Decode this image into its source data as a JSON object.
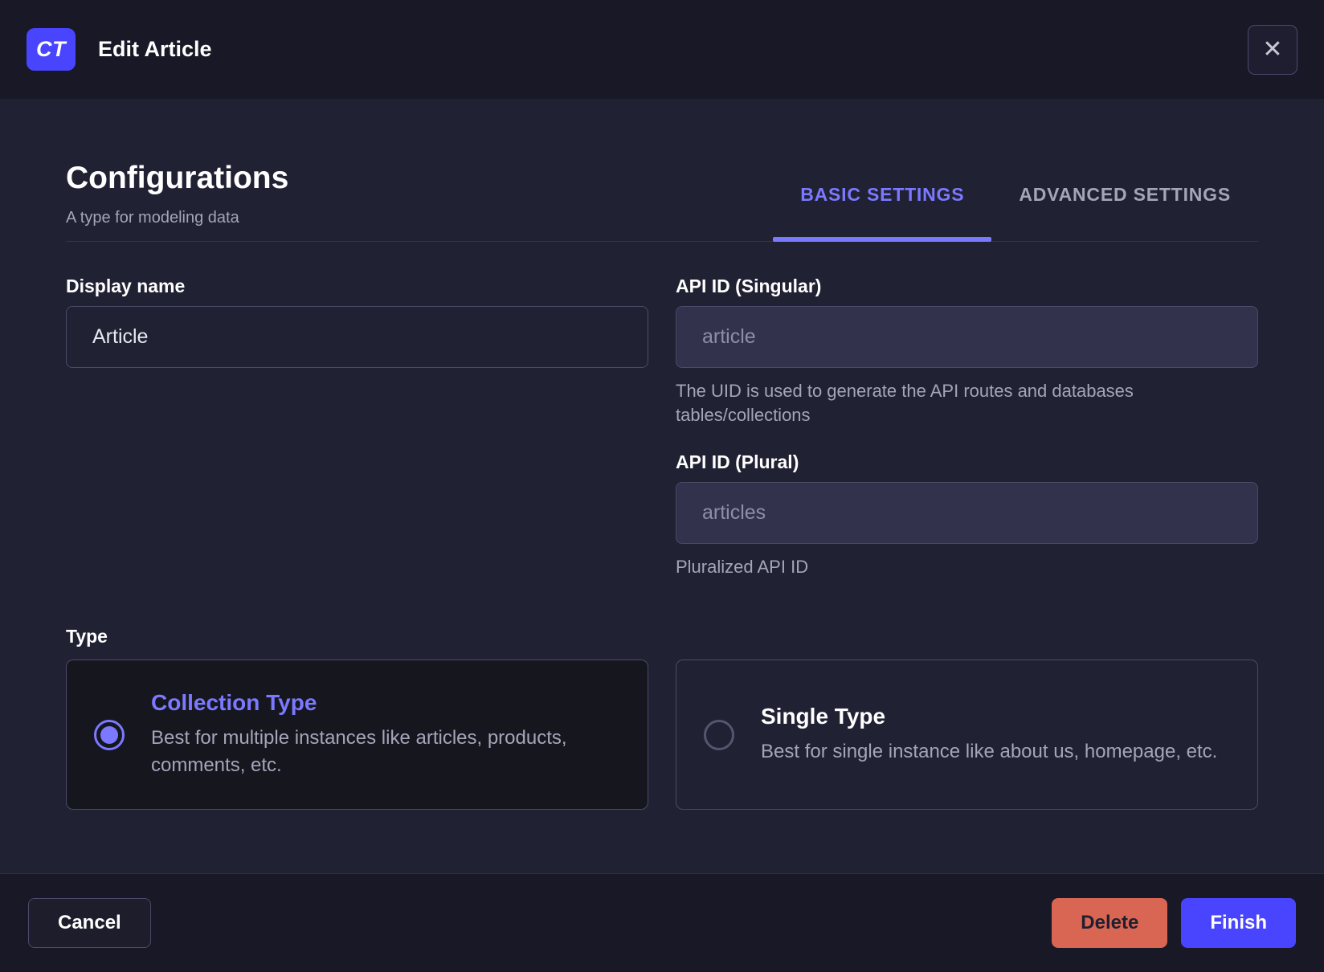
{
  "header": {
    "badge": "CT",
    "title": "Edit Article",
    "close_icon": "✕"
  },
  "config": {
    "title": "Configurations",
    "subtitle": "A type for modeling data",
    "tabs": [
      {
        "label": "BASIC SETTINGS",
        "active": true
      },
      {
        "label": "ADVANCED SETTINGS",
        "active": false
      }
    ]
  },
  "form": {
    "display_name": {
      "label": "Display name",
      "value": "Article"
    },
    "api_id_singular": {
      "label": "API ID (Singular)",
      "value": "article",
      "hint": "The UID is used to generate the API routes and databases tables/collections"
    },
    "api_id_plural": {
      "label": "API ID (Plural)",
      "value": "articles",
      "hint": "Pluralized API ID"
    },
    "type": {
      "label": "Type",
      "options": [
        {
          "title": "Collection Type",
          "description": "Best for multiple instances like articles, products, comments, etc.",
          "selected": true
        },
        {
          "title": "Single Type",
          "description": "Best for single instance like about us, homepage, etc.",
          "selected": false
        }
      ]
    }
  },
  "footer": {
    "cancel_label": "Cancel",
    "delete_label": "Delete",
    "finish_label": "Finish"
  },
  "colors": {
    "accent": "#4945ff",
    "accent_light": "#7b79ff",
    "danger": "#d96553",
    "header_bg": "#181826",
    "body_bg": "#212134"
  }
}
